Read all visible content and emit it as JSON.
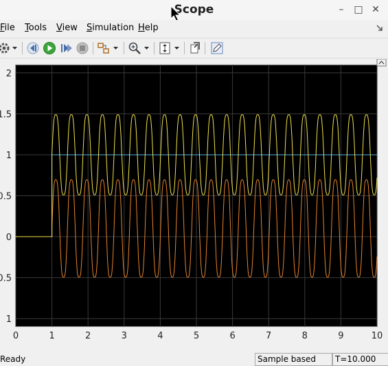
{
  "window": {
    "title": "Scope",
    "minimize_glyph": "–",
    "maximize_glyph": "□",
    "close_glyph": "✕"
  },
  "menu": [
    {
      "label": "File",
      "ul": "F",
      "rest": "ile"
    },
    {
      "label": "Tools",
      "ul": "T",
      "rest": "ools"
    },
    {
      "label": "View",
      "ul": "V",
      "rest": "iew"
    },
    {
      "label": "Simulation",
      "ul": "S",
      "rest": "imulation"
    },
    {
      "label": "Help",
      "ul": "H",
      "rest": "elp"
    }
  ],
  "toolbar": {
    "icons": [
      "settings-icon",
      "step-back-icon",
      "run-icon",
      "step-forward-icon",
      "stop-icon",
      "highlight-block-icon",
      "zoom-icon",
      "autoscale-icon",
      "restore-layout-icon",
      "edit-icon"
    ]
  },
  "chart_data": {
    "type": "line",
    "xlim": [
      0,
      10
    ],
    "ylim": [
      -1.1,
      2.1
    ],
    "x_ticks": [
      "0",
      "1",
      "2",
      "3",
      "4",
      "5",
      "6",
      "7",
      "8",
      "9",
      "10"
    ],
    "y_ticks": [
      "2",
      "1.5",
      "1",
      "0.5",
      "0",
      "0.5",
      "1"
    ],
    "y_tick_values": [
      2,
      1.5,
      1,
      0.5,
      0,
      -0.5,
      -1
    ],
    "grid": true,
    "background": "#000000",
    "series": [
      {
        "color": "#4fb0e8",
        "description_points": [
          [
            0,
            0
          ],
          [
            1,
            0
          ],
          [
            1,
            1
          ],
          [
            10,
            1
          ]
        ]
      },
      {
        "color": "#f2e34c",
        "start": 1,
        "offset": 1,
        "amplitude": 0.7,
        "period": 0.43
      },
      {
        "color": "#e8842e",
        "start": 1,
        "offset": 0.1,
        "amplitude": 0.85,
        "period": 0.43
      }
    ]
  },
  "status": {
    "ready": "Ready",
    "mode": "Sample based",
    "time": "T=10.000"
  },
  "colors": {
    "grid": "#3a3a3a",
    "axis_border": "#cfcfcf"
  }
}
